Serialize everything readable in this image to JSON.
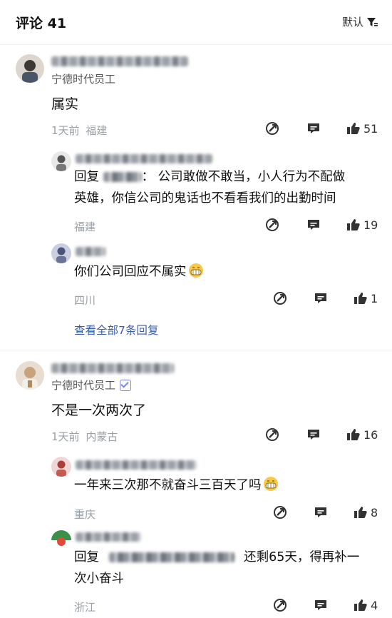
{
  "header": {
    "title": "评论 41",
    "sort_label": "默认"
  },
  "comments": [
    {
      "role": "宁德时代员工",
      "text": "属实",
      "time": "1天前",
      "location": "福建",
      "likes": "51",
      "replies": [
        {
          "prefix": "回复",
          "target_sep": "：",
          "text_line1": "公司敢做不敢当，小人行为不配做",
          "text_line2": "英雄，你信公司的鬼话也不看看我们的出勤时间",
          "location": "福建",
          "likes": "19"
        },
        {
          "text": "你们公司回应不属实",
          "location": "四川",
          "likes": "1"
        }
      ],
      "view_all": "查看全部7条回复"
    },
    {
      "role": "宁德时代员工",
      "text": "不是一次两次了",
      "time": "1天前",
      "location": "内蒙古",
      "likes": "16",
      "replies": [
        {
          "text": "一年来三次那不就奋斗三百天了吗",
          "location": "重庆",
          "likes": "8"
        },
        {
          "prefix": "回复",
          "text_line1": "还剩65天，得再补一",
          "text_line2": "次小奋斗",
          "location": "浙江",
          "likes": "4"
        }
      ]
    }
  ]
}
